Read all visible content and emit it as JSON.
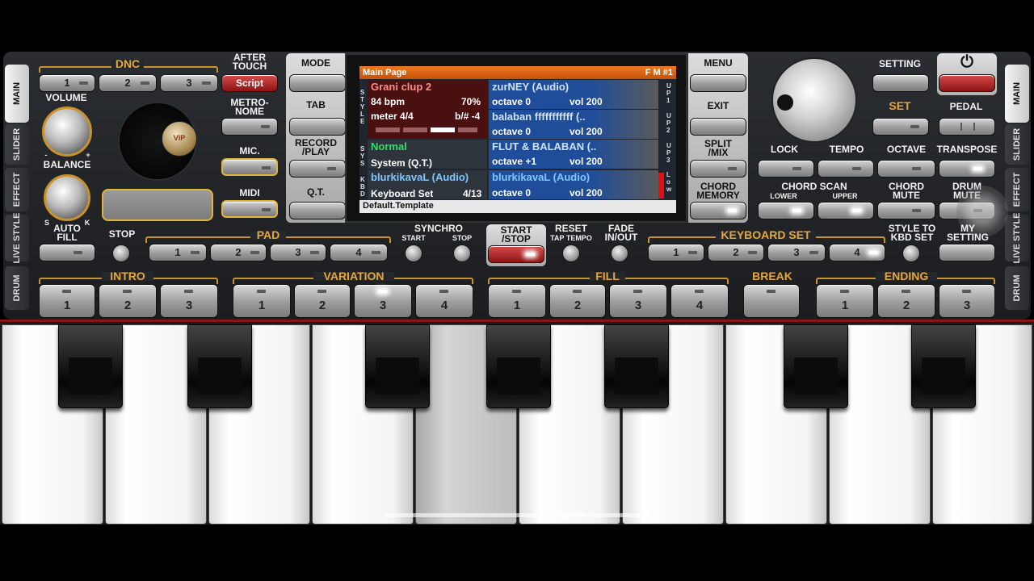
{
  "sidebar_left": [
    "MAIN",
    "SLIDER",
    "EFFECT",
    "LIVE STYLE",
    "DRUM"
  ],
  "sidebar_right": [
    "MAIN",
    "SLIDER",
    "EFFECT",
    "LIVE STYLE",
    "DRUM"
  ],
  "left": {
    "dnc": "DNC",
    "dnc_buttons": [
      "1",
      "2",
      "3"
    ],
    "script": "Script",
    "after_touch": "AFTER\nTOUCH",
    "volume": "VOLUME",
    "balance": "BALANCE",
    "balance_minus": "-",
    "balance_plus": "+",
    "auto_fill": "AUTO\nFILL",
    "auto_s": "S",
    "auto_k": "K",
    "metronome": "METRO-\nNOME",
    "mic": "MIC.",
    "midi": "MIDI",
    "vip": "VIP"
  },
  "center_left": {
    "mode": "MODE",
    "tab": "TAB",
    "record_play": "RECORD\n/PLAY",
    "qt": "Q.T."
  },
  "center_right": {
    "menu": "MENU",
    "exit": "EXIT",
    "split_mix": "SPLIT\n/MIX",
    "chord_memory": "CHORD\nMEMORY"
  },
  "screen": {
    "title": "Main Page",
    "fm": "F M #1",
    "style_name": "Grani clup 2",
    "bpm": "84 bpm",
    "volume_pct": "70%",
    "meter": "meter 4/4",
    "transpose": "b/# -4",
    "sys_mode": "Normal",
    "sys_name": "System (Q.T.)",
    "kbd_name": "blurkikavaL (Audio)",
    "kbd_set": "Keyboard Set",
    "kbd_page": "4/13",
    "template": "Default.Template",
    "side_style": "STYLE",
    "side_sys": "SYS",
    "side_kbd": "KBD",
    "voices": [
      {
        "name": "zurNEY (Audio)",
        "octave": "octave  0",
        "vol": "vol 200",
        "tag": "UP1"
      },
      {
        "name": "balaban fffffffffff (..",
        "octave": "octave  0",
        "vol": "vol 200",
        "tag": "UP2"
      },
      {
        "name": "FLUT & BALABAN (..",
        "octave": "octave +1",
        "vol": "vol 200",
        "tag": "UP3"
      },
      {
        "name": "blurkikavaL (Audio)",
        "octave": "octave  0",
        "vol": "vol 200",
        "tag": "Low"
      }
    ]
  },
  "right": {
    "setting": "SETTING",
    "set": "SET",
    "pedal": "PEDAL",
    "power": "⏻",
    "lock": "LOCK",
    "tempo": "TEMPO",
    "octave": "OCTAVE",
    "transpose": "TRANSPOSE",
    "chord_scan": "CHORD SCAN",
    "lower": "LOWER",
    "upper": "UPPER",
    "chord_mute": "CHORD\nMUTE",
    "drum_mute": "DRUM\nMUTE"
  },
  "row3": {
    "stop": "STOP",
    "pad": "PAD",
    "pad_buttons": [
      "1",
      "2",
      "3",
      "4"
    ],
    "synchro": "SYNCHRO",
    "sync_start": "START",
    "sync_stop": "STOP",
    "start_stop": "START\n/STOP",
    "reset": "RESET",
    "tap_tempo": "TAP TEMPO",
    "fade": "FADE\nIN/OUT",
    "keyboard_set": "KEYBOARD SET",
    "kbd_buttons": [
      "1",
      "2",
      "3",
      "4"
    ],
    "style_to_kbd": "STYLE TO\nKBD SET",
    "my_setting": "MY\nSETTING"
  },
  "row4": {
    "intro": "INTRO",
    "intro_buttons": [
      "1",
      "2",
      "3"
    ],
    "variation": "VARIATION",
    "variation_buttons": [
      "1",
      "2",
      "3",
      "4"
    ],
    "fill": "FILL",
    "fill_buttons": [
      "1",
      "2",
      "3",
      "4"
    ],
    "break": "BREAK",
    "ending": "ENDING",
    "ending_buttons": [
      "1",
      "2",
      "3"
    ]
  }
}
